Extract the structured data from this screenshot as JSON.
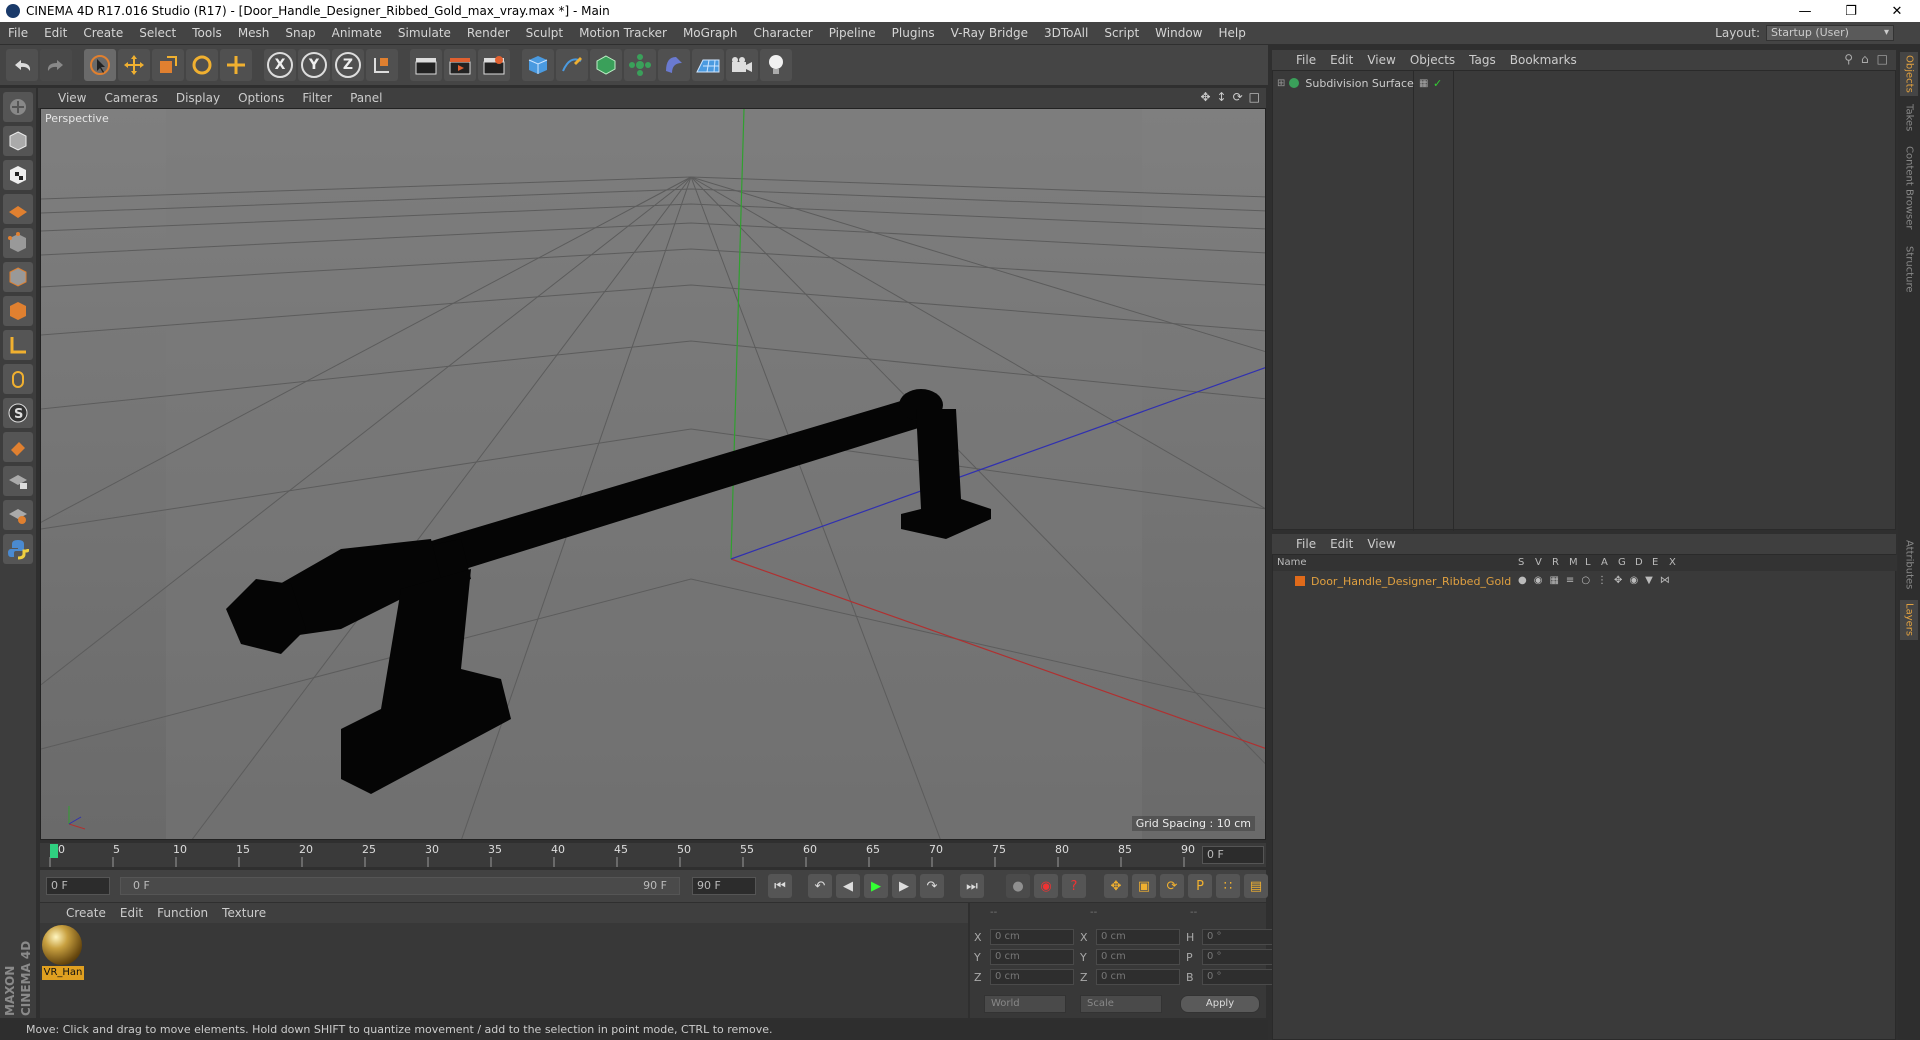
{
  "window": {
    "title": "CINEMA 4D R17.016 Studio (R17) - [Door_Handle_Designer_Ribbed_Gold_max_vray.max *] - Main"
  },
  "menubar": [
    "File",
    "Edit",
    "Create",
    "Select",
    "Tools",
    "Mesh",
    "Snap",
    "Animate",
    "Simulate",
    "Render",
    "Sculpt",
    "Motion Tracker",
    "MoGraph",
    "Character",
    "Pipeline",
    "Plugins",
    "V-Ray Bridge",
    "3DToAll",
    "Script",
    "Window",
    "Help"
  ],
  "layout": {
    "label": "Layout:",
    "value": "Startup (User)"
  },
  "viewport": {
    "menu": [
      "View",
      "Cameras",
      "Display",
      "Options",
      "Filter",
      "Panel"
    ],
    "label": "Perspective",
    "grid_spacing": "Grid Spacing : 10 cm"
  },
  "timeline": {
    "ticks": [
      "0",
      "5",
      "10",
      "15",
      "20",
      "25",
      "30",
      "35",
      "40",
      "45",
      "50",
      "55",
      "60",
      "65",
      "70",
      "75",
      "80",
      "85",
      "90"
    ],
    "current_frame": "0 F",
    "start_field": "0 F",
    "range_start": "0 F",
    "range_end": "90 F",
    "end_field": "90 F"
  },
  "material_manager": {
    "menu": [
      "Create",
      "Edit",
      "Function",
      "Texture"
    ],
    "material_name": "VR_Han"
  },
  "coordinates": {
    "headers": [
      "--",
      "--",
      "--"
    ],
    "rows": [
      {
        "l1": "X",
        "v1": "0 cm",
        "l2": "X",
        "v2": "0 cm",
        "l3": "H",
        "v3": "0 °"
      },
      {
        "l1": "Y",
        "v1": "0 cm",
        "l2": "Y",
        "v2": "0 cm",
        "l3": "P",
        "v3": "0 °"
      },
      {
        "l1": "Z",
        "v1": "0 cm",
        "l2": "Z",
        "v2": "0 cm",
        "l3": "B",
        "v3": "0 °"
      }
    ],
    "mode": "World",
    "transform": "Scale",
    "apply": "Apply"
  },
  "object_manager": {
    "menu": [
      "File",
      "Edit",
      "View",
      "Objects",
      "Tags",
      "Bookmarks"
    ],
    "objects": [
      {
        "name": "Subdivision Surface"
      }
    ]
  },
  "layer_manager": {
    "menu": [
      "File",
      "Edit",
      "View"
    ],
    "columns": [
      "Name",
      "S",
      "V",
      "R",
      "M",
      "L",
      "A",
      "G",
      "D",
      "E",
      "X"
    ],
    "layers": [
      {
        "name": "Door_Handle_Designer_Ribbed_Gold",
        "color": "#e06a1a"
      }
    ]
  },
  "side_tabs": [
    "Objects",
    "Takes",
    "Content Browser",
    "Structure",
    "Attributes",
    "Layers"
  ],
  "branding": "MAXON CINEMA 4D",
  "status": "Move: Click and drag to move elements. Hold down SHIFT to quantize movement / add to the selection in point mode, CTRL to remove.",
  "colors": {
    "accent": "#e0a040",
    "layer": "#e06a1a",
    "x_axis": "#c03030",
    "y_axis": "#30a030",
    "z_axis": "#3030c0"
  }
}
